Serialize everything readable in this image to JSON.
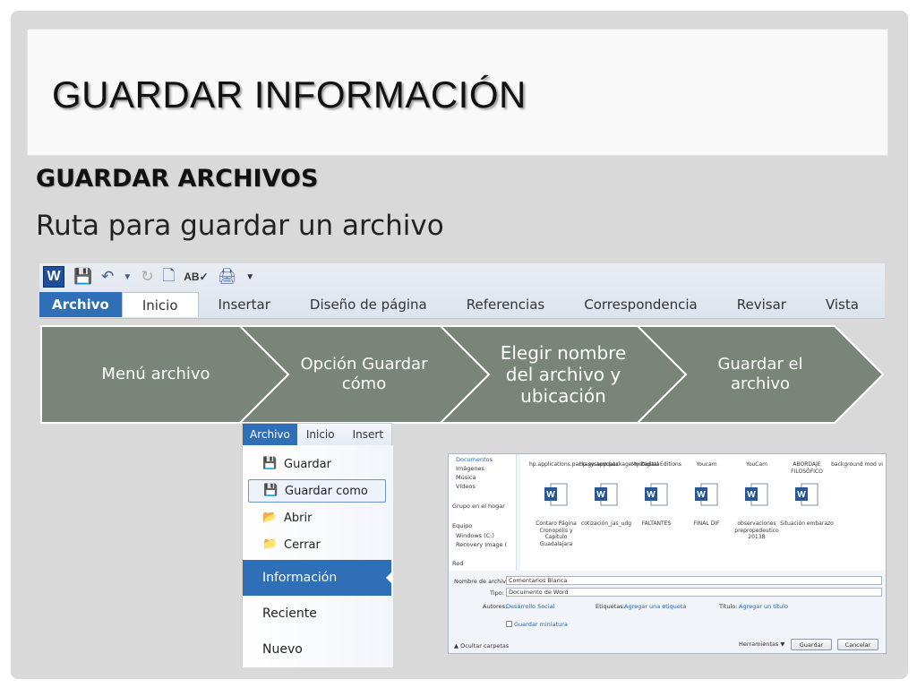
{
  "slide": {
    "title": "GUARDAR INFORMACIÓN",
    "subheading": "GUARDAR ARCHIVOS",
    "route_text": "Ruta para guardar un archivo"
  },
  "ribbon": {
    "logo": "W",
    "tabs": [
      "Archivo",
      "Inicio",
      "Insertar",
      "Diseño de página",
      "Referencias",
      "Correspondencia",
      "Revisar",
      "Vista"
    ]
  },
  "process": {
    "color": "#7a8579",
    "steps": [
      "Menú archivo",
      "Opción Guardar cómo",
      "Elegir nombre del archivo y ubicación",
      "Guardar el archivo"
    ]
  },
  "file_menu": {
    "tabs": [
      "Archivo",
      "Inicio",
      "Insert"
    ],
    "items": [
      "Guardar",
      "Guardar como",
      "Abrir",
      "Cerrar"
    ],
    "sections": [
      "Información",
      "Reciente",
      "Nuevo"
    ]
  },
  "save_dialog": {
    "tree": [
      "Documentos",
      "Imágenes",
      "Música",
      "Vídeos",
      "Grupo en el hogar",
      "Equipo",
      "Windows (C:)",
      "Recovery Image (",
      "Red"
    ],
    "top_files": [
      "hp.applications.package.appdata",
      "hp.system.package.metadata",
      "My Digital Editions",
      "Youcam",
      "YouCam",
      "ABORDAJE FILOSÓFICO",
      "background mod vi"
    ],
    "word_files": [
      "Contaro Página Cronopolis y Capitulo Guadalajara",
      "cotización_jas_udg",
      "FALTANTES",
      "FINAL DIF",
      "observaciones prepropedeutico 2013B",
      "Situación embarazo"
    ],
    "filename_label": "Nombre de archivo:",
    "filename_value": "Comentarios Blanca",
    "type_label": "Tipo:",
    "type_value": "Documento de Word",
    "authors_label": "Autores:",
    "authors_value": "Desarrollo Social",
    "tags_label": "Etiquetas:",
    "tags_value": "Agregar una etiqueta",
    "title_label": "Título:",
    "title_value": "Agregar un título",
    "thumbnail_label": "Guardar miniatura",
    "hide_folders": "Ocultar carpetas",
    "tools": "Herramientas",
    "save_btn": "Guardar",
    "cancel_btn": "Cancelar"
  }
}
